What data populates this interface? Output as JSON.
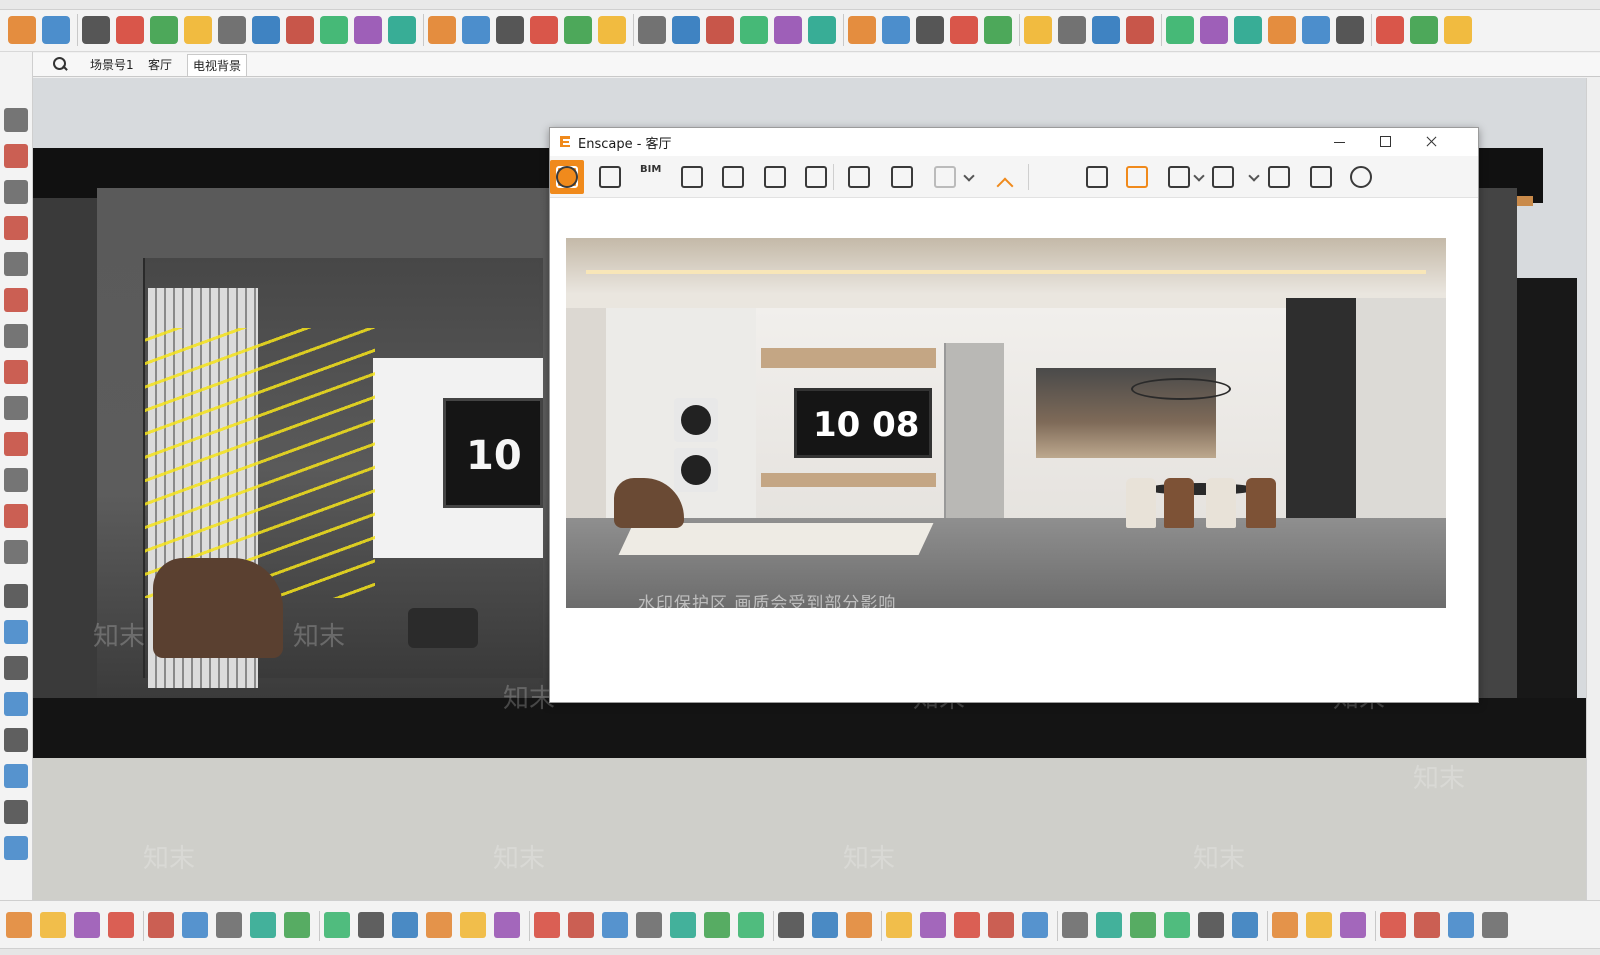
{
  "scene_tabs": [
    "场景号1",
    "客厅",
    "电视背景"
  ],
  "active_scene_tab": 2,
  "enscape": {
    "title": "Enscape - 客厅",
    "toolbar_bim_label": "BIM",
    "render": {
      "tv_clock": "10 08",
      "watermark": "水印保护区 画质会受到部分影响"
    }
  },
  "viewport": {
    "tv_clock_partial": "10",
    "watermark_text": "知末"
  },
  "colors": {
    "enscape_accent": "#f08a1c",
    "toolbar_bg": "#f3f3f3",
    "viewport_bg": "#d7dadd",
    "axis_yellow": "#f5e31a"
  },
  "top_toolbar_icons": [
    "section-plane-icon",
    "select-arrow-icon",
    "eraser-icon",
    "paint-bucket-icon",
    "push-pull-icon",
    "follow-me-icon",
    "offset-icon",
    "tape-measure-icon",
    "protractor-icon",
    "rotate-icon",
    "scale-icon",
    "move-icon",
    "enscape-logo-icon",
    "refresh-icon",
    "sync-icon",
    "plus-circle-icon",
    "tree-icon",
    "stairs-icon",
    "checker-icon",
    "cloud-upload-icon",
    "settings-gears-icon",
    "mail-icon",
    "info-icon",
    "user-icon",
    "import-icon",
    "export-icon",
    "fire-icon",
    "gear-red-icon",
    "pin-arrow-icon",
    "curve-tool-icon",
    "move-cross-icon",
    "light-bulb-icon",
    "link-icon",
    "cloud-link-icon",
    "cloud-icon",
    "cloud-list-icon",
    "shape-icon",
    "network-icon",
    "refresh-check-icon",
    "download-circle-icon",
    "gear-blue-icon",
    "chrome-icon"
  ],
  "left_toolbar_icons": [
    "select-icon",
    "eraser-icon",
    "pencil-icon",
    "freehand-icon",
    "rectangle-icon",
    "circle-icon",
    "arc-icon",
    "pie-icon",
    "push-pull-icon",
    "follow-me-icon",
    "rotate-icon",
    "dimension-icon",
    "text-icon",
    "axes-icon",
    "pan-hand-icon",
    "zoom-icon",
    "zoom-window-icon",
    "look-around-icon",
    "walk-icon",
    "section-icon",
    "sandbox-icon"
  ],
  "enscape_toolbar_icons": [
    "home-icon",
    "location-pin-icon",
    "bim-icon",
    "binoculars-icon",
    "compass-icon",
    "buildings-icon",
    "clapper-icon",
    "screenshot-batch-icon",
    "batch-render-icon",
    "panorama-360-icon",
    "collapse-up-icon",
    "map-icon",
    "asset-library-icon",
    "section-toggle-icon",
    "material-icon",
    "vr-headset-icon",
    "visual-settings-icon",
    "gear-settings-icon",
    "help-icon"
  ],
  "bottom_toolbar_icons": [
    "wall-tool-icon",
    "door-tool-icon",
    "grid-icon",
    "window-tool-icon",
    "axis-xyz-icon",
    "blue-box-icon",
    "stack-icon",
    "panel-icon",
    "frame-icon",
    "move-four-icon",
    "red-arrow-icon",
    "green-cube-icon",
    "phone-curve-icon",
    "circle-green-icon",
    "trash-icon",
    "export-tag-icon",
    "slash-box-icon",
    "green-bars-icon",
    "green-flag-icon",
    "arrows-icon",
    "cursor-icon",
    "red-cursor-icon",
    "list-icon",
    "hand-curve-icon",
    "edit-icon",
    "search-doc-icon",
    "chart-a-icon",
    "chart-b-icon",
    "h-measure-icon",
    "number-321-a-icon",
    "number-321-b-icon",
    "dimension-h-icon",
    "green-stack-icon",
    "white-box-icon",
    "white-cubes-icon",
    "snowflake-icon",
    "network-red-icon",
    "calendar-icon",
    "green-book-icon",
    "orange-book-icon",
    "green-box-icon",
    "brush-icon",
    "green-gear-icon"
  ]
}
